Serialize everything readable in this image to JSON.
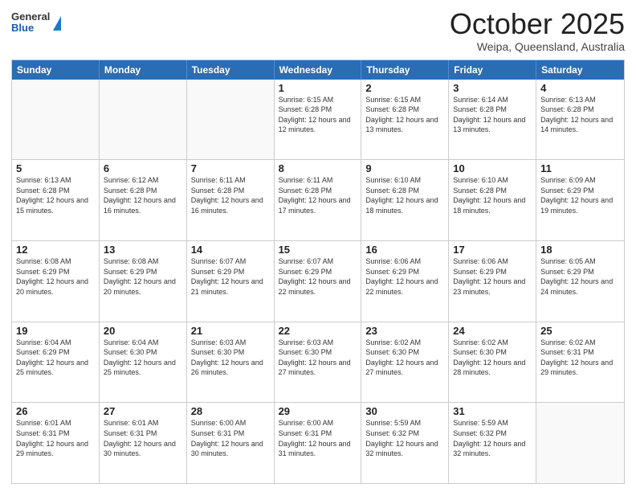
{
  "header": {
    "logo_general": "General",
    "logo_blue": "Blue",
    "month_title": "October 2025",
    "location": "Weipa, Queensland, Australia"
  },
  "weekdays": [
    "Sunday",
    "Monday",
    "Tuesday",
    "Wednesday",
    "Thursday",
    "Friday",
    "Saturday"
  ],
  "rows": [
    [
      {
        "day": "",
        "info": ""
      },
      {
        "day": "",
        "info": ""
      },
      {
        "day": "",
        "info": ""
      },
      {
        "day": "1",
        "info": "Sunrise: 6:15 AM\nSunset: 6:28 PM\nDaylight: 12 hours\nand 12 minutes."
      },
      {
        "day": "2",
        "info": "Sunrise: 6:15 AM\nSunset: 6:28 PM\nDaylight: 12 hours\nand 13 minutes."
      },
      {
        "day": "3",
        "info": "Sunrise: 6:14 AM\nSunset: 6:28 PM\nDaylight: 12 hours\nand 13 minutes."
      },
      {
        "day": "4",
        "info": "Sunrise: 6:13 AM\nSunset: 6:28 PM\nDaylight: 12 hours\nand 14 minutes."
      }
    ],
    [
      {
        "day": "5",
        "info": "Sunrise: 6:13 AM\nSunset: 6:28 PM\nDaylight: 12 hours\nand 15 minutes."
      },
      {
        "day": "6",
        "info": "Sunrise: 6:12 AM\nSunset: 6:28 PM\nDaylight: 12 hours\nand 16 minutes."
      },
      {
        "day": "7",
        "info": "Sunrise: 6:11 AM\nSunset: 6:28 PM\nDaylight: 12 hours\nand 16 minutes."
      },
      {
        "day": "8",
        "info": "Sunrise: 6:11 AM\nSunset: 6:28 PM\nDaylight: 12 hours\nand 17 minutes."
      },
      {
        "day": "9",
        "info": "Sunrise: 6:10 AM\nSunset: 6:28 PM\nDaylight: 12 hours\nand 18 minutes."
      },
      {
        "day": "10",
        "info": "Sunrise: 6:10 AM\nSunset: 6:28 PM\nDaylight: 12 hours\nand 18 minutes."
      },
      {
        "day": "11",
        "info": "Sunrise: 6:09 AM\nSunset: 6:29 PM\nDaylight: 12 hours\nand 19 minutes."
      }
    ],
    [
      {
        "day": "12",
        "info": "Sunrise: 6:08 AM\nSunset: 6:29 PM\nDaylight: 12 hours\nand 20 minutes."
      },
      {
        "day": "13",
        "info": "Sunrise: 6:08 AM\nSunset: 6:29 PM\nDaylight: 12 hours\nand 20 minutes."
      },
      {
        "day": "14",
        "info": "Sunrise: 6:07 AM\nSunset: 6:29 PM\nDaylight: 12 hours\nand 21 minutes."
      },
      {
        "day": "15",
        "info": "Sunrise: 6:07 AM\nSunset: 6:29 PM\nDaylight: 12 hours\nand 22 minutes."
      },
      {
        "day": "16",
        "info": "Sunrise: 6:06 AM\nSunset: 6:29 PM\nDaylight: 12 hours\nand 22 minutes."
      },
      {
        "day": "17",
        "info": "Sunrise: 6:06 AM\nSunset: 6:29 PM\nDaylight: 12 hours\nand 23 minutes."
      },
      {
        "day": "18",
        "info": "Sunrise: 6:05 AM\nSunset: 6:29 PM\nDaylight: 12 hours\nand 24 minutes."
      }
    ],
    [
      {
        "day": "19",
        "info": "Sunrise: 6:04 AM\nSunset: 6:29 PM\nDaylight: 12 hours\nand 25 minutes."
      },
      {
        "day": "20",
        "info": "Sunrise: 6:04 AM\nSunset: 6:30 PM\nDaylight: 12 hours\nand 25 minutes."
      },
      {
        "day": "21",
        "info": "Sunrise: 6:03 AM\nSunset: 6:30 PM\nDaylight: 12 hours\nand 26 minutes."
      },
      {
        "day": "22",
        "info": "Sunrise: 6:03 AM\nSunset: 6:30 PM\nDaylight: 12 hours\nand 27 minutes."
      },
      {
        "day": "23",
        "info": "Sunrise: 6:02 AM\nSunset: 6:30 PM\nDaylight: 12 hours\nand 27 minutes."
      },
      {
        "day": "24",
        "info": "Sunrise: 6:02 AM\nSunset: 6:30 PM\nDaylight: 12 hours\nand 28 minutes."
      },
      {
        "day": "25",
        "info": "Sunrise: 6:02 AM\nSunset: 6:31 PM\nDaylight: 12 hours\nand 29 minutes."
      }
    ],
    [
      {
        "day": "26",
        "info": "Sunrise: 6:01 AM\nSunset: 6:31 PM\nDaylight: 12 hours\nand 29 minutes."
      },
      {
        "day": "27",
        "info": "Sunrise: 6:01 AM\nSunset: 6:31 PM\nDaylight: 12 hours\nand 30 minutes."
      },
      {
        "day": "28",
        "info": "Sunrise: 6:00 AM\nSunset: 6:31 PM\nDaylight: 12 hours\nand 30 minutes."
      },
      {
        "day": "29",
        "info": "Sunrise: 6:00 AM\nSunset: 6:31 PM\nDaylight: 12 hours\nand 31 minutes."
      },
      {
        "day": "30",
        "info": "Sunrise: 5:59 AM\nSunset: 6:32 PM\nDaylight: 12 hours\nand 32 minutes."
      },
      {
        "day": "31",
        "info": "Sunrise: 5:59 AM\nSunset: 6:32 PM\nDaylight: 12 hours\nand 32 minutes."
      },
      {
        "day": "",
        "info": ""
      }
    ]
  ]
}
